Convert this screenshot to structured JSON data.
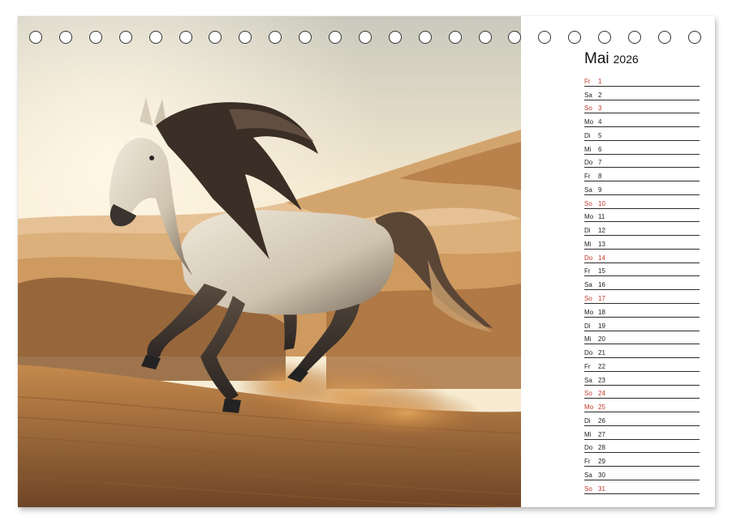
{
  "calendar": {
    "month": "Mai",
    "year": "2026",
    "highlight_color": "#c0392b",
    "days": [
      {
        "weekday": "Fr",
        "day": "1",
        "highlight": true
      },
      {
        "weekday": "Sa",
        "day": "2",
        "highlight": false
      },
      {
        "weekday": "So",
        "day": "3",
        "highlight": true
      },
      {
        "weekday": "Mo",
        "day": "4",
        "highlight": false
      },
      {
        "weekday": "Di",
        "day": "5",
        "highlight": false
      },
      {
        "weekday": "Mi",
        "day": "6",
        "highlight": false
      },
      {
        "weekday": "Do",
        "day": "7",
        "highlight": false
      },
      {
        "weekday": "Fr",
        "day": "8",
        "highlight": false
      },
      {
        "weekday": "Sa",
        "day": "9",
        "highlight": false
      },
      {
        "weekday": "So",
        "day": "10",
        "highlight": true
      },
      {
        "weekday": "Mo",
        "day": "11",
        "highlight": false
      },
      {
        "weekday": "Di",
        "day": "12",
        "highlight": false
      },
      {
        "weekday": "Mi",
        "day": "13",
        "highlight": false
      },
      {
        "weekday": "Do",
        "day": "14",
        "highlight": true
      },
      {
        "weekday": "Fr",
        "day": "15",
        "highlight": false
      },
      {
        "weekday": "Sa",
        "day": "16",
        "highlight": false
      },
      {
        "weekday": "So",
        "day": "17",
        "highlight": true
      },
      {
        "weekday": "Mo",
        "day": "18",
        "highlight": false
      },
      {
        "weekday": "Di",
        "day": "19",
        "highlight": false
      },
      {
        "weekday": "Mi",
        "day": "20",
        "highlight": false
      },
      {
        "weekday": "Do",
        "day": "21",
        "highlight": false
      },
      {
        "weekday": "Fr",
        "day": "22",
        "highlight": false
      },
      {
        "weekday": "Sa",
        "day": "23",
        "highlight": false
      },
      {
        "weekday": "So",
        "day": "24",
        "highlight": true
      },
      {
        "weekday": "Mo",
        "day": "25",
        "highlight": true
      },
      {
        "weekday": "Di",
        "day": "26",
        "highlight": false
      },
      {
        "weekday": "Mi",
        "day": "27",
        "highlight": false
      },
      {
        "weekday": "Do",
        "day": "28",
        "highlight": false
      },
      {
        "weekday": "Fr",
        "day": "29",
        "highlight": false
      },
      {
        "weekday": "Sa",
        "day": "30",
        "highlight": false
      },
      {
        "weekday": "So",
        "day": "31",
        "highlight": true
      }
    ]
  },
  "photo": {
    "subject": "horse-galloping-in-desert",
    "colors": {
      "sky_top": "#c9c9bd",
      "sky_glow": "#f7ecd2",
      "dune": "#d9a66c",
      "dune_shadow": "#6e4a2a",
      "sand_foreground": "#b07a43",
      "horse_body": "#d8cdb9",
      "horse_dark": "#3a3430",
      "mane": "#3b2e26"
    }
  },
  "binding": {
    "ring_count": 23,
    "ring_color": "#333333"
  }
}
